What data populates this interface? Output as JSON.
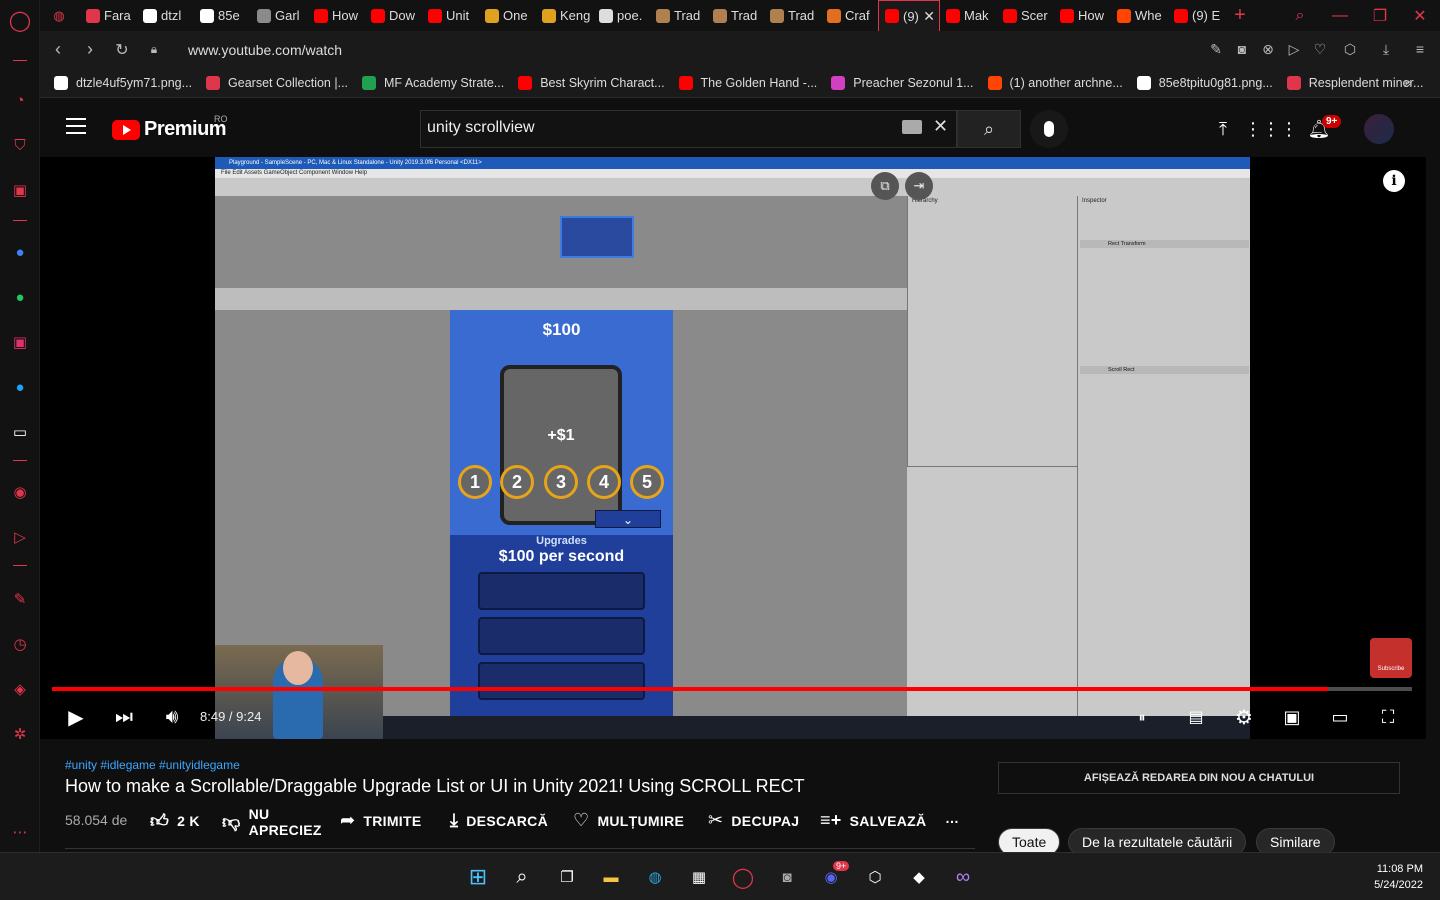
{
  "browser": {
    "tabs": [
      {
        "label": "Fara",
        "favicon": "ec-icon",
        "color": "#e0364c"
      },
      {
        "label": "dtzl",
        "favicon": "globe-icon",
        "color": "#ffffff"
      },
      {
        "label": "85e",
        "favicon": "globe-icon",
        "color": "#ffffff"
      },
      {
        "label": "Garl",
        "favicon": "game-icon",
        "color": "#8a8a8a"
      },
      {
        "label": "How",
        "favicon": "youtube-icon",
        "color": "#ff0000"
      },
      {
        "label": "Dow",
        "favicon": "youtube-icon",
        "color": "#ff0000"
      },
      {
        "label": "Unit",
        "favicon": "youtube-icon",
        "color": "#ff0000"
      },
      {
        "label": "One",
        "favicon": "mf-icon",
        "color": "#e0a020"
      },
      {
        "label": "Keng",
        "favicon": "mf-icon",
        "color": "#e0a020"
      },
      {
        "label": "poe.",
        "favicon": "poe-icon",
        "color": "#dddddd"
      },
      {
        "label": "Trad",
        "favicon": "trade-icon",
        "color": "#b08050"
      },
      {
        "label": "Trad",
        "favicon": "trade-icon",
        "color": "#b08050"
      },
      {
        "label": "Trad",
        "favicon": "trade-icon",
        "color": "#b08050"
      },
      {
        "label": "Craf",
        "favicon": "craft-icon",
        "color": "#e07020"
      },
      {
        "label": "(9)",
        "favicon": "youtube-icon",
        "color": "#ff0000",
        "active": true
      },
      {
        "label": "Mak",
        "favicon": "youtube-icon",
        "color": "#ff0000"
      },
      {
        "label": "Scer",
        "favicon": "youtube-icon",
        "color": "#ff0000"
      },
      {
        "label": "How",
        "favicon": "youtube-icon",
        "color": "#ff0000"
      },
      {
        "label": "Whe",
        "favicon": "reddit-icon",
        "color": "#ff4500"
      },
      {
        "label": "(9) E",
        "favicon": "youtube-icon",
        "color": "#ff0000"
      }
    ],
    "url": "www.youtube.com/watch",
    "bookmarks": [
      {
        "label": "dtzle4uf5ym71.png...",
        "favicon": "file-icon",
        "color": "#ffffff"
      },
      {
        "label": "Gearset Collection |...",
        "favicon": "ec-icon",
        "color": "#e0364c"
      },
      {
        "label": "MF Academy Strate...",
        "favicon": "sheets-icon",
        "color": "#20a050"
      },
      {
        "label": "Best Skyrim Charact...",
        "favicon": "youtube-icon",
        "color": "#ff0000"
      },
      {
        "label": "The Golden Hand -...",
        "favicon": "youtube-icon",
        "color": "#ff0000"
      },
      {
        "label": "Preacher Sezonul 1...",
        "favicon": "play-circle-icon",
        "color": "#d040c0"
      },
      {
        "label": "(1) another archne...",
        "favicon": "reddit-icon",
        "color": "#ff4500"
      },
      {
        "label": "85e8tpitu0g81.png...",
        "favicon": "file-icon",
        "color": "#ffffff"
      },
      {
        "label": "Resplendent miner...",
        "favicon": "ec-icon",
        "color": "#e0364c"
      }
    ]
  },
  "youtube": {
    "logo_text": "Premium",
    "country_code": "RO",
    "search_query": "unity scrollview",
    "notification_count": "9+",
    "video": {
      "current_time": "8:49",
      "duration": "9:24",
      "time_display": "8:49 / 9:24",
      "progress": 0.938,
      "hashtags": "#unity #idlegame #unityidlegame",
      "title": "How to make a Scrollable/Draggable Upgrade List or UI in Unity 2021! Using SCROLL RECT",
      "views": "58.054 de",
      "likes": "2 K",
      "dislike_label_1": "NU",
      "dislike_label_2": "APRECIEZ",
      "share_label": "TRIMITE",
      "download_label": "DESCARCĂ",
      "thanks_label": "MULȚUMIRE",
      "clip_label": "DECUPAJ",
      "save_label": "SALVEAZĂ",
      "more_label": "…"
    },
    "video_content": {
      "unity_window_title": "Playground - SampleScene - PC, Mac & Linux Standalone - Unity 2019.3.0f6 Personal <DX11>",
      "unity_menu": "File   Edit   Assets   GameObject   Component   Window   Help",
      "price": "$100",
      "plus_one": "+$1",
      "levels": [
        "1",
        "2",
        "3",
        "4",
        "5"
      ],
      "upgrades_header": "Upgrades",
      "upgrade_text": "$100 per second",
      "hierarchy_title": "Hierarchy",
      "inspector_title": "Inspector",
      "scroll_rect_label": "Scroll Rect",
      "rect_transform_label": "Rect Transform"
    },
    "sidebar": {
      "chat_replay": "AFIȘEAZĂ REDAREA DIN NOU A CHATULUI",
      "chips": [
        "Toate",
        "De la rezultatele căutării",
        "Similare"
      ],
      "subscribe_watermark": "Subscribe"
    }
  },
  "taskbar": {
    "time": "11:08 PM",
    "date": "5/24/2022",
    "discord_badge": "9+"
  },
  "colors": {
    "accent": "#e0364c",
    "youtube_red": "#ff0000",
    "link_blue": "#3ea6ff"
  }
}
